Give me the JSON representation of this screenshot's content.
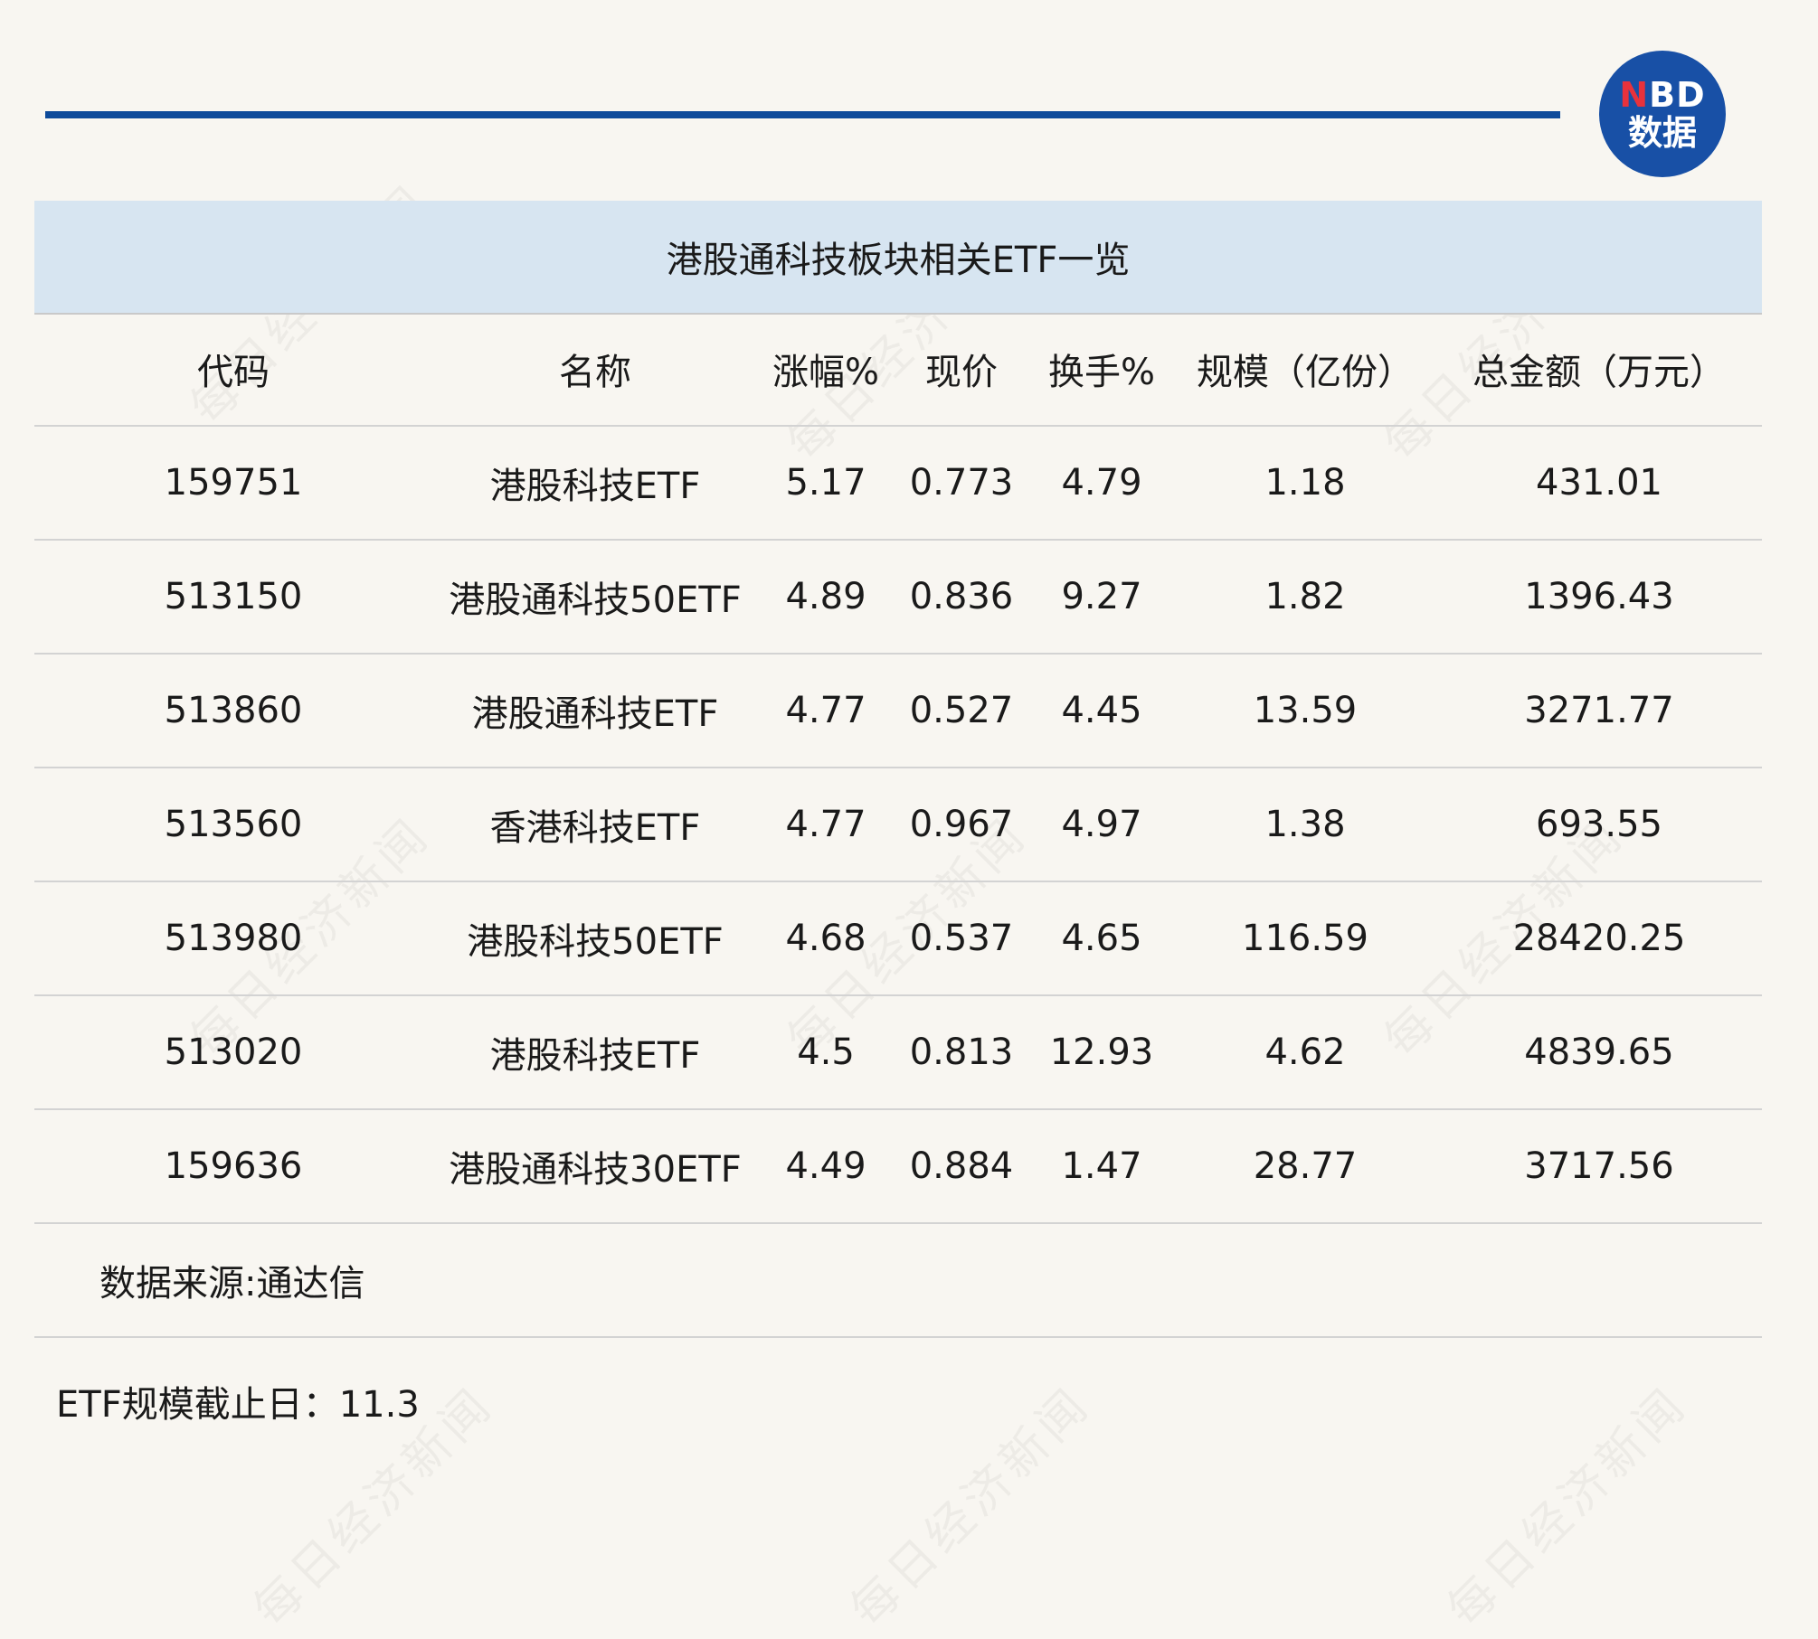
{
  "logo": {
    "brand_n": "N",
    "brand_bd": "BD",
    "brand_cn": "数据"
  },
  "watermark_text": "每日经济新闻",
  "title": "港股通科技板块相关ETF一览",
  "headers": [
    "代码",
    "名称",
    "涨幅%",
    "现价",
    "换手%",
    "规模（亿份）",
    "总金额（万元）"
  ],
  "rows": [
    [
      "159751",
      "港股科技ETF",
      "5.17",
      "0.773",
      "4.79",
      "1.18",
      "431.01"
    ],
    [
      "513150",
      "港股通科技50ETF",
      "4.89",
      "0.836",
      "9.27",
      "1.82",
      "1396.43"
    ],
    [
      "513860",
      "港股通科技ETF",
      "4.77",
      "0.527",
      "4.45",
      "13.59",
      "3271.77"
    ],
    [
      "513560",
      "香港科技ETF",
      "4.77",
      "0.967",
      "4.97",
      "1.38",
      "693.55"
    ],
    [
      "513980",
      "港股科技50ETF",
      "4.68",
      "0.537",
      "4.65",
      "116.59",
      "28420.25"
    ],
    [
      "513020",
      "港股科技ETF",
      "4.5",
      "0.813",
      "12.93",
      "4.62",
      "4839.65"
    ],
    [
      "159636",
      "港股通科技30ETF",
      "4.49",
      "0.884",
      "1.47",
      "28.77",
      "3717.56"
    ]
  ],
  "source": "数据来源:通达信",
  "note": "ETF规模截止日：11.3",
  "colors": {
    "accent": "#0d4a9a",
    "title_band": "#d7e5f1",
    "logo_bg": "#1850a6",
    "logo_red": "#e8323c",
    "background": "#f8f6f1"
  }
}
